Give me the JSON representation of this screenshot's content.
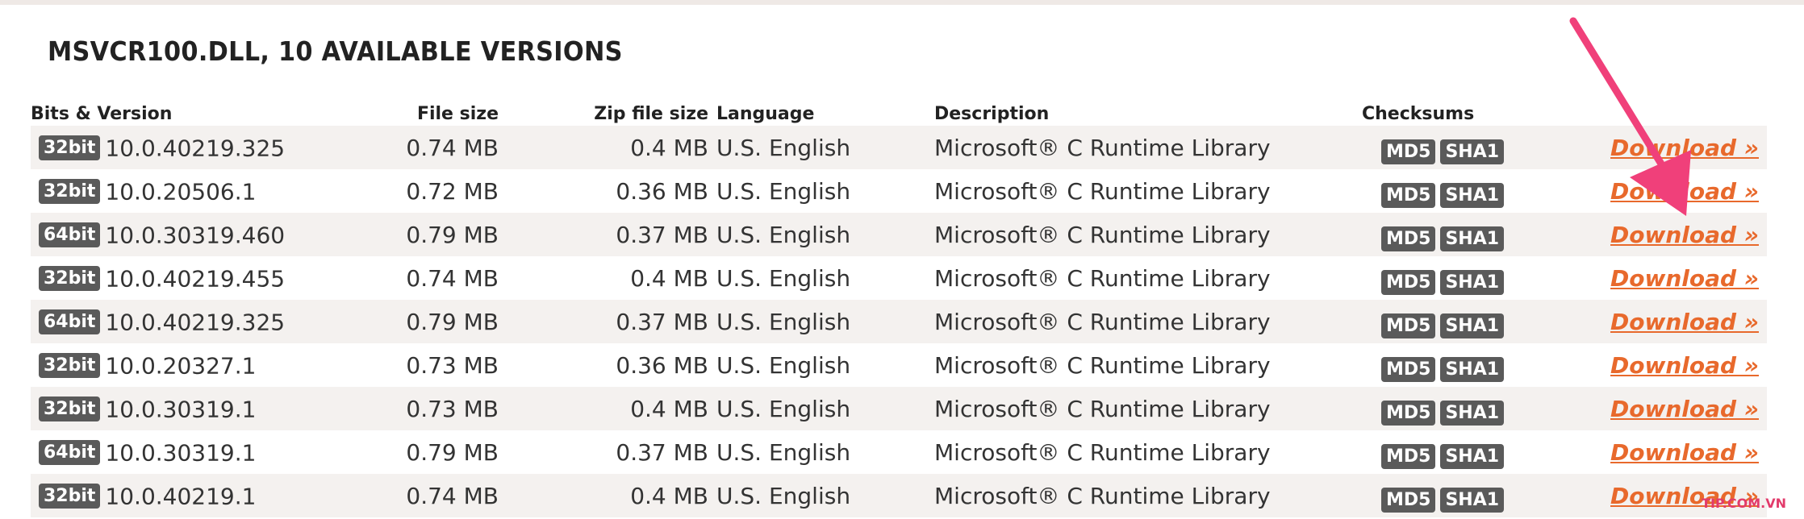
{
  "page_title": "MSVCR100.DLL, 10 AVAILABLE VERSIONS",
  "table": {
    "headers": {
      "bits_version": "Bits & Version",
      "file_size": "File size",
      "zip_size": "Zip file size",
      "language": "Language",
      "description": "Description",
      "checksums": "Checksums"
    },
    "md5_label": "MD5",
    "sha1_label": "SHA1",
    "download_label": "Download »",
    "rows": [
      {
        "bits": "32bit",
        "version": "10.0.40219.325",
        "file_size": "0.74 MB",
        "zip_size": "0.4 MB",
        "language": "U.S. English",
        "description": "Microsoft® C Runtime Library"
      },
      {
        "bits": "32bit",
        "version": "10.0.20506.1",
        "file_size": "0.72 MB",
        "zip_size": "0.36 MB",
        "language": "U.S. English",
        "description": "Microsoft® C Runtime Library"
      },
      {
        "bits": "64bit",
        "version": "10.0.30319.460",
        "file_size": "0.79 MB",
        "zip_size": "0.37 MB",
        "language": "U.S. English",
        "description": "Microsoft® C Runtime Library"
      },
      {
        "bits": "32bit",
        "version": "10.0.40219.455",
        "file_size": "0.74 MB",
        "zip_size": "0.4 MB",
        "language": "U.S. English",
        "description": "Microsoft® C Runtime Library"
      },
      {
        "bits": "64bit",
        "version": "10.0.40219.325",
        "file_size": "0.79 MB",
        "zip_size": "0.37 MB",
        "language": "U.S. English",
        "description": "Microsoft® C Runtime Library"
      },
      {
        "bits": "32bit",
        "version": "10.0.20327.1",
        "file_size": "0.73 MB",
        "zip_size": "0.36 MB",
        "language": "U.S. English",
        "description": "Microsoft® C Runtime Library"
      },
      {
        "bits": "32bit",
        "version": "10.0.30319.1",
        "file_size": "0.73 MB",
        "zip_size": "0.4 MB",
        "language": "U.S. English",
        "description": "Microsoft® C Runtime Library"
      },
      {
        "bits": "64bit",
        "version": "10.0.30319.1",
        "file_size": "0.79 MB",
        "zip_size": "0.37 MB",
        "language": "U.S. English",
        "description": "Microsoft® C Runtime Library"
      },
      {
        "bits": "32bit",
        "version": "10.0.40219.1",
        "file_size": "0.74 MB",
        "zip_size": "0.4 MB",
        "language": "U.S. English",
        "description": "Microsoft® C Runtime Library"
      }
    ]
  },
  "annotation": {
    "icon": "arrow-pointer-icon",
    "color": "#f0407a"
  },
  "watermark": "TIP.COM.VN"
}
